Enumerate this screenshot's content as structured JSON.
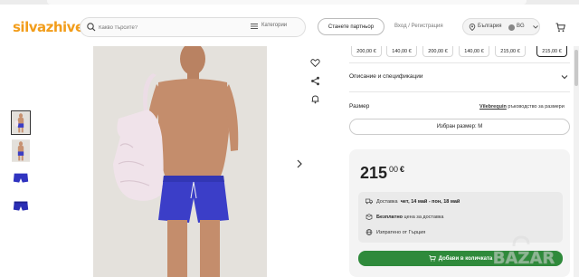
{
  "header": {
    "logo_text": "silvazhive",
    "search_placeholder": "Какво търсите?",
    "categories_label": "Категории",
    "partner_button": "Станете партньор",
    "login_link": "Вход / Регистрация",
    "country": "България",
    "language": "BG"
  },
  "gallery": {
    "thumbnails": 4,
    "active_index": 0
  },
  "sizes": {
    "prices": [
      "200,00 €",
      "140,00 €",
      "200,00 €",
      "140,00 €",
      "215,00 €",
      "215,00 €"
    ],
    "selected_index": 5
  },
  "details": {
    "description_label": "Описание и спецификации",
    "size_label": "Размер",
    "size_guide_brand": "Vilebrequin",
    "size_guide_text": "ръководство за размери",
    "selected_size_text": "Избран размер: M"
  },
  "price": {
    "whole": "215",
    "cents": "00",
    "currency": "€"
  },
  "info": {
    "delivery_label": "Доставка",
    "delivery_dates": "чет, 14 май - пон, 18 май",
    "free_label": "Безплатно",
    "free_text": "цена за доставка",
    "ship_text": "Изпратено от Гърция"
  },
  "add_to_cart": "Добави в количката",
  "watermark_text": "BAZAR"
}
